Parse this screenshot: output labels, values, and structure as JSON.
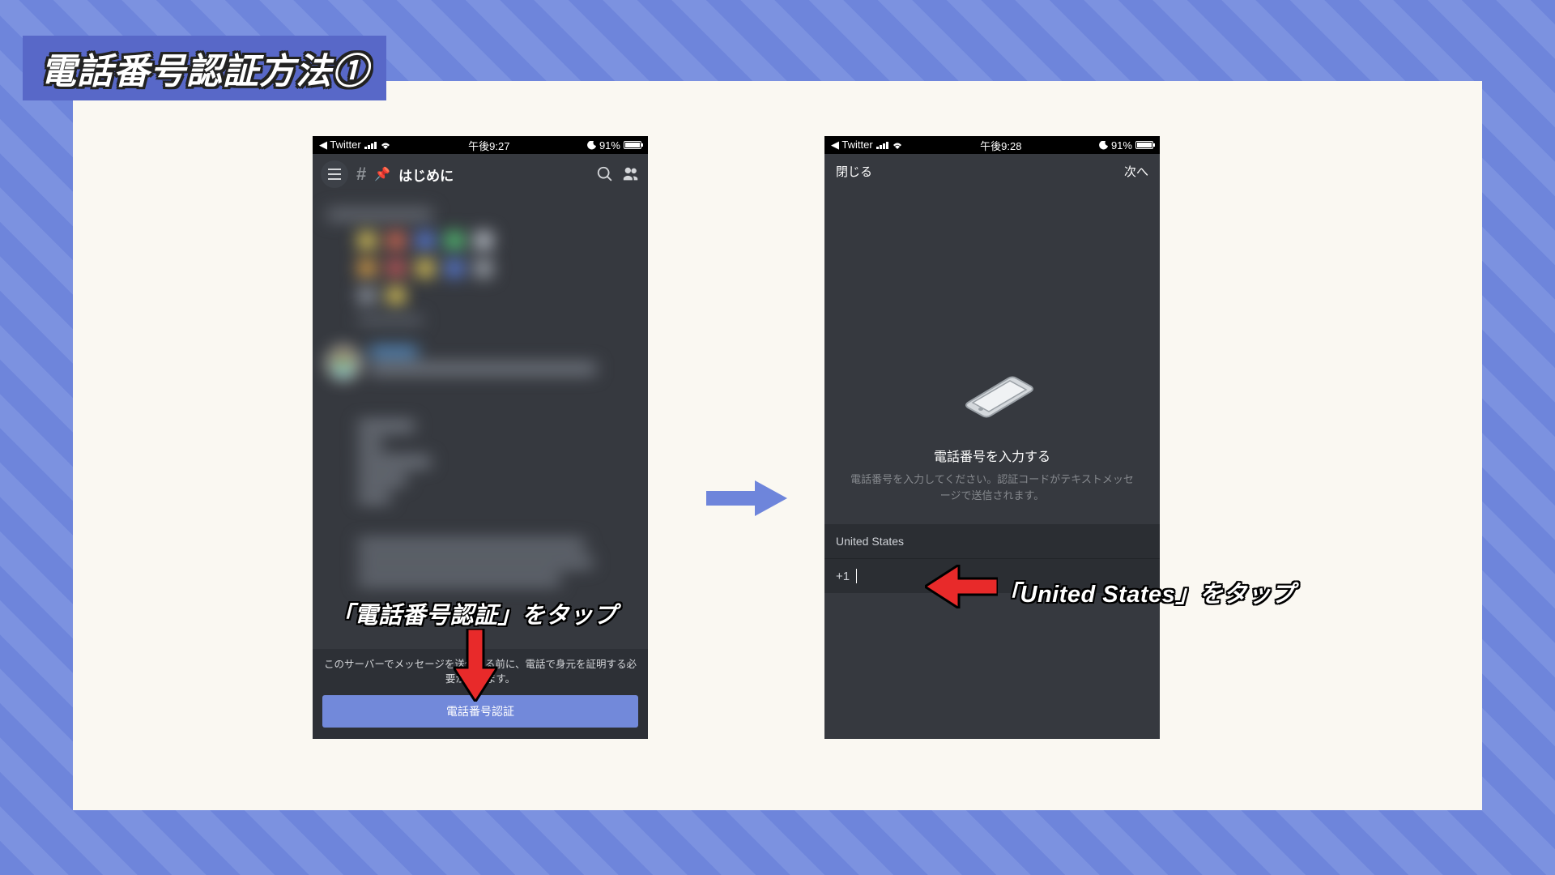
{
  "slide": {
    "title": "電話番号認証方法①"
  },
  "phone_left": {
    "status": {
      "back_app": "◀ Twitter",
      "time": "午後9:27",
      "battery": "91%"
    },
    "nav": {
      "channel": "はじめに"
    },
    "footer": {
      "notice": "このサーバーでメッセージを送信する前に、電話で身元を証明する必要があります。",
      "button": "電話番号認証"
    }
  },
  "phone_right": {
    "status": {
      "back_app": "◀ Twitter",
      "time": "午後9:28",
      "battery": "91%"
    },
    "modal": {
      "close": "閉じる",
      "next": "次へ",
      "title": "電話番号を入力する",
      "subtitle": "電話番号を入力してください。認証コードがテキストメッセージで送信されます。",
      "country": "United States",
      "prefix": "+1"
    }
  },
  "callouts": {
    "left": "「電話番号認証」をタップ",
    "right": "「United States」をタップ"
  }
}
